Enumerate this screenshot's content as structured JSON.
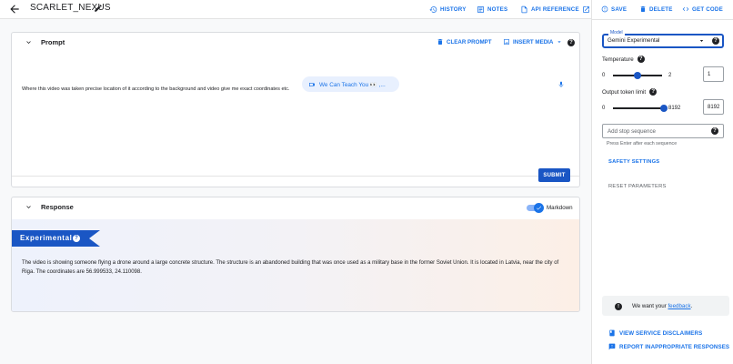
{
  "header": {
    "title": "SCARLET_NEXUS",
    "history_label": "HISTORY",
    "notes_label": "NOTES",
    "api_label": "API REFERENCE"
  },
  "prompt": {
    "title": "Prompt",
    "clear_label": "CLEAR PROMPT",
    "insert_label": "INSERT MEDIA",
    "help": "?",
    "text": "Where this video was taken precise location of it according to the background and video give me exact coordinates etc.",
    "video_chip": "We Can Teach You 👀 ,...",
    "submit_label": "SUBMIT"
  },
  "response": {
    "title": "Response",
    "markdown_label": "Markdown",
    "markdown_enabled": true,
    "banner_label": "Experimental",
    "banner_help": "?",
    "text": "The video is showing someone flying a drone around a large concrete structure. The structure is an abandoned building that was once used as a military base in the former Soviet Union. It is located in Latvia, near the city of Riga. The coordinates are 56.999533, 24.110098."
  },
  "sidebar": {
    "save_label": "SAVE",
    "delete_label": "DELETE",
    "code_label": "GET CODE",
    "model_floating_label": "Model",
    "model_value": "Gemini Experimental",
    "temperature_label": "Temperature",
    "temperature_min": "0",
    "temperature_max": "2",
    "temperature_value": "1",
    "temperature_fraction": 0.5,
    "token_label": "Output token limit",
    "token_min": "0",
    "token_max": "8192",
    "token_value": "8192",
    "token_fraction": 1.0,
    "stop_placeholder": "Add stop sequence",
    "stop_hint": "Press Enter after each sequence",
    "safety_label": "SAFETY SETTINGS",
    "reset_label": "RESET PARAMETERS",
    "feedback_prefix": "We want your",
    "feedback_link": "feedback",
    "feedback_suffix": ".",
    "disclaimers_label": "VIEW SERVICE DISCLAIMERS",
    "report_label": "REPORT INAPPROPRIATE RESPONSES"
  },
  "colors": {
    "accent": "#1a73e8",
    "accent_dark": "#1a56c4"
  },
  "icons": {
    "back": "arrow-left-icon",
    "edit": "pencil-icon",
    "history": "history-icon",
    "notes": "notes-icon",
    "api": "document-icon",
    "external": "external-link-icon",
    "save": "save-icon",
    "delete": "trash-icon",
    "code": "code-icon",
    "video": "video-icon",
    "mic": "microphone-icon"
  }
}
